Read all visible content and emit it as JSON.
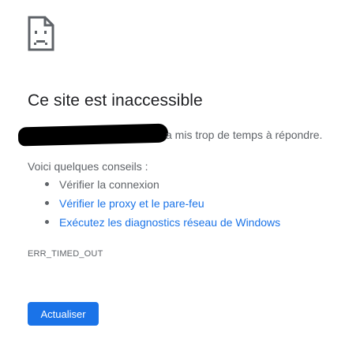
{
  "error": {
    "icon": "sad-page-icon",
    "title": "Ce site est inaccessible",
    "description_suffix": "a mis trop de temps à répondre.",
    "suggestions_heading": "Voici quelques conseils :",
    "suggestions": [
      {
        "label": "Vérifier la connexion",
        "is_link": false
      },
      {
        "label": "Vérifier le proxy et le pare-feu",
        "is_link": true
      },
      {
        "label": "Exécutez les diagnostics réseau de Windows",
        "is_link": true
      }
    ],
    "code": "ERR_TIMED_OUT",
    "reload_label": "Actualiser"
  },
  "colors": {
    "title": "#202124",
    "text": "#5f6368",
    "link": "#1a73e8",
    "button": "#1a73e8",
    "button_text": "#ffffff",
    "redaction": "#000000"
  }
}
